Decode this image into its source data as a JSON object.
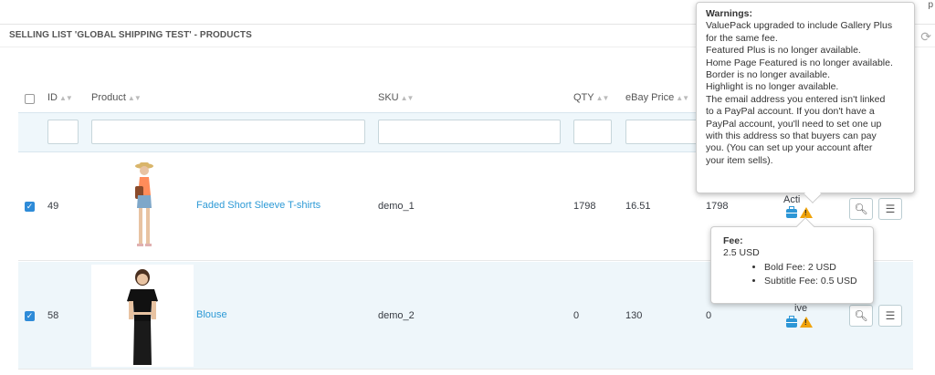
{
  "top_cut_text": "p",
  "panel": {
    "title": "SELLING LIST 'GLOBAL SHIPPING TEST' - PRODUCTS"
  },
  "columns": {
    "id": "ID",
    "product": "Product",
    "sku": "SKU",
    "qty": "QTY",
    "ebay_price": "eBay Price",
    "sort_glyph": "▲▼"
  },
  "rows": [
    {
      "checked": true,
      "id": "49",
      "product": "Faded Short Sleeve T-shirts",
      "sku": "demo_1",
      "qty": "1798",
      "ebay_price": "16.51",
      "available_qty": "1798",
      "status": "Acti"
    },
    {
      "checked": true,
      "id": "58",
      "product": "Blouse",
      "sku": "demo_2",
      "qty": "0",
      "ebay_price": "130",
      "available_qty": "0",
      "status": "ive"
    }
  ],
  "warnings_tooltip": {
    "title": "Warnings:",
    "lines": [
      "ValuePack upgraded to include Gallery Plus",
      "for the same fee.",
      "Featured Plus is no longer available.",
      "Home Page Featured is no longer available.",
      "Border is no longer available.",
      "Highlight is no longer available.",
      "The email address you entered isn't linked",
      "to a PayPal account. If you don't have a",
      "PayPal account, you'll need to set one up",
      "with this address so that buyers can pay",
      "you. (You can set up your account after",
      "your item sells)."
    ]
  },
  "fee_tooltip": {
    "title": "Fee:",
    "total": "2.5 USD",
    "items": [
      "Bold Fee: 2 USD",
      "Subtitle Fee: 0.5 USD"
    ]
  },
  "icons": {
    "view": "magnifier-icon",
    "details": "list-details-icon",
    "status_ebay": "shopping-bag-icon",
    "status_warning": "warning-icon",
    "refresh": "refresh-icon"
  },
  "colors": {
    "link": "#2d9ad6",
    "checkbox": "#2e8bd8",
    "warning": "#f0a30a",
    "filter_bg": "#eff7fb",
    "row_alt": "#eef6fa"
  }
}
